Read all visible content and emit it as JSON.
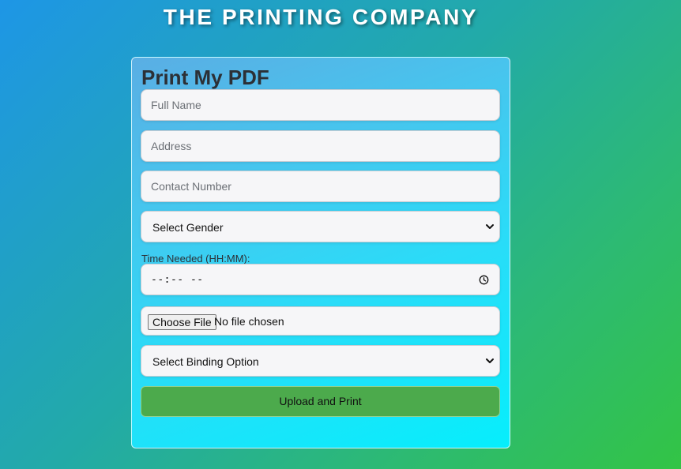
{
  "header": {
    "title": "THE PRINTING COMPANY"
  },
  "form": {
    "title": "Print My PDF",
    "full_name_placeholder": "Full Name",
    "address_placeholder": "Address",
    "contact_placeholder": "Contact Number",
    "gender_selected": "Select Gender",
    "time_label": "Time Needed (HH:MM):",
    "time_value": "--:-- --",
    "file_button_label": "Choose File",
    "file_status": "No file chosen",
    "binding_selected": "Select Binding Option",
    "submit_label": "Upload and Print"
  },
  "colors": {
    "submit_button": "#4caa4c",
    "title_text": "#ffffff",
    "field_background": "#f6f6f8"
  },
  "icons": {
    "select_arrow": "chevron-down-icon",
    "time_picker": "clock-icon"
  }
}
